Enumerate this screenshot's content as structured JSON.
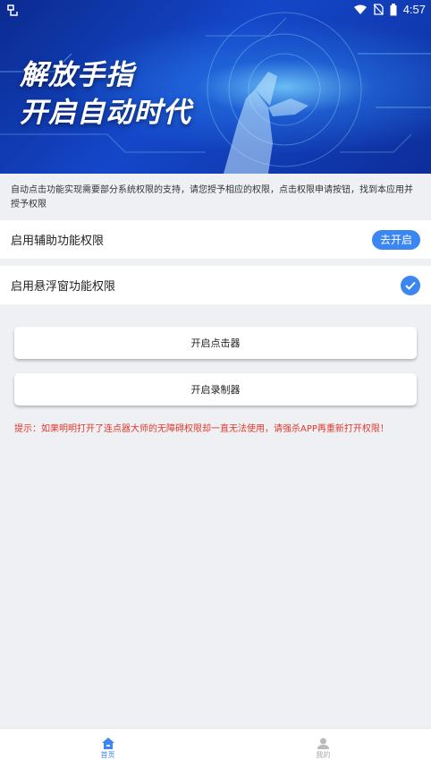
{
  "status_bar": {
    "time": "4:57",
    "icons": [
      "app-logo-icon",
      "wifi-icon",
      "no-sim-icon",
      "battery-icon"
    ]
  },
  "banner": {
    "title_line1": "解放手指",
    "title_line2": "开启自动时代"
  },
  "notice": "自动点击功能实现需要部分系统权限的支持，请您授予相应的权限，点击权限申请按钮，找到本应用并授予权限",
  "permissions": [
    {
      "label": "启用辅助功能权限",
      "action": "去开启",
      "granted": false
    },
    {
      "label": "启用悬浮窗功能权限",
      "granted": true,
      "icon": "check-circle-icon"
    }
  ],
  "buttons": {
    "start_clicker": "开启点击器",
    "start_recorder": "开启录制器"
  },
  "tip": "提示：如果明明打开了连点器大师的无障碍权限却一直无法使用，请强杀APP再重新打开权限！",
  "tabs": [
    {
      "label": "首页",
      "icon": "home-icon",
      "active": true
    },
    {
      "label": "我的",
      "icon": "user-icon",
      "active": false
    }
  ],
  "colors": {
    "accent": "#3b86f0",
    "tip": "#e0382b",
    "banner_dark": "#0b2a8f"
  }
}
